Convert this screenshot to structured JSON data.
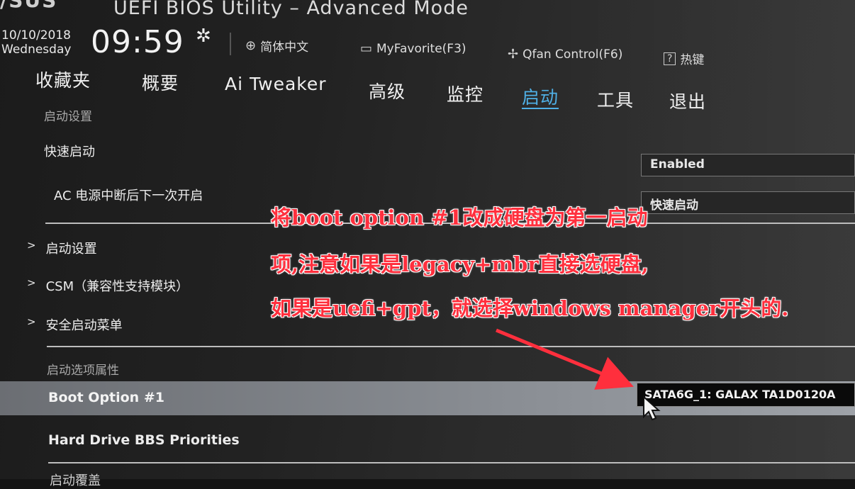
{
  "header": {
    "logo": "/SUS",
    "title": "UEFI BIOS Utility – Advanced Mode",
    "date": "10/10/2018",
    "day": "Wednesday",
    "time": "09:59",
    "items": [
      {
        "icon": "globe-icon",
        "label": "简体中文"
      },
      {
        "icon": "favorite-icon",
        "label": "MyFavorite(F3)"
      },
      {
        "icon": "fan-icon",
        "label": "Qfan Control(F6)"
      },
      {
        "icon": "help-icon",
        "label": "热键"
      }
    ]
  },
  "tabs": [
    {
      "label": "收藏夹",
      "active": false
    },
    {
      "label": "概要",
      "active": false
    },
    {
      "label": "Ai Tweaker",
      "active": false
    },
    {
      "label": "高级",
      "active": false
    },
    {
      "label": "监控",
      "active": false
    },
    {
      "label": "启动",
      "active": true
    },
    {
      "label": "工具",
      "active": false
    },
    {
      "label": "退出",
      "active": false
    }
  ],
  "content": {
    "section1_title": "启动设置",
    "fast_boot_label": "快速启动",
    "fast_boot_value": "Enabled",
    "ac_label": "AC 电源中断后下一次开启",
    "ac_value": "快速启动",
    "submenus": [
      "启动设置",
      "CSM（兼容性支持模块）",
      "安全启动菜单"
    ],
    "section2_title": "启动选项属性",
    "boot_option_label": "Boot Option #1",
    "boot_option_value": "SATA6G_1: GALAX TA1D0120A",
    "hdd_bbs_label": "Hard Drive BBS Priorities",
    "bottom_partial": "启动覆盖"
  },
  "annotation": {
    "lines": [
      "将boot option #1改成硬盘为第一启动",
      "项,注意如果是legacy+mbr直接选硬盘,",
      "如果是uefi+gpt，就选择windows manager开头的."
    ],
    "color": "#ff2f3d"
  }
}
